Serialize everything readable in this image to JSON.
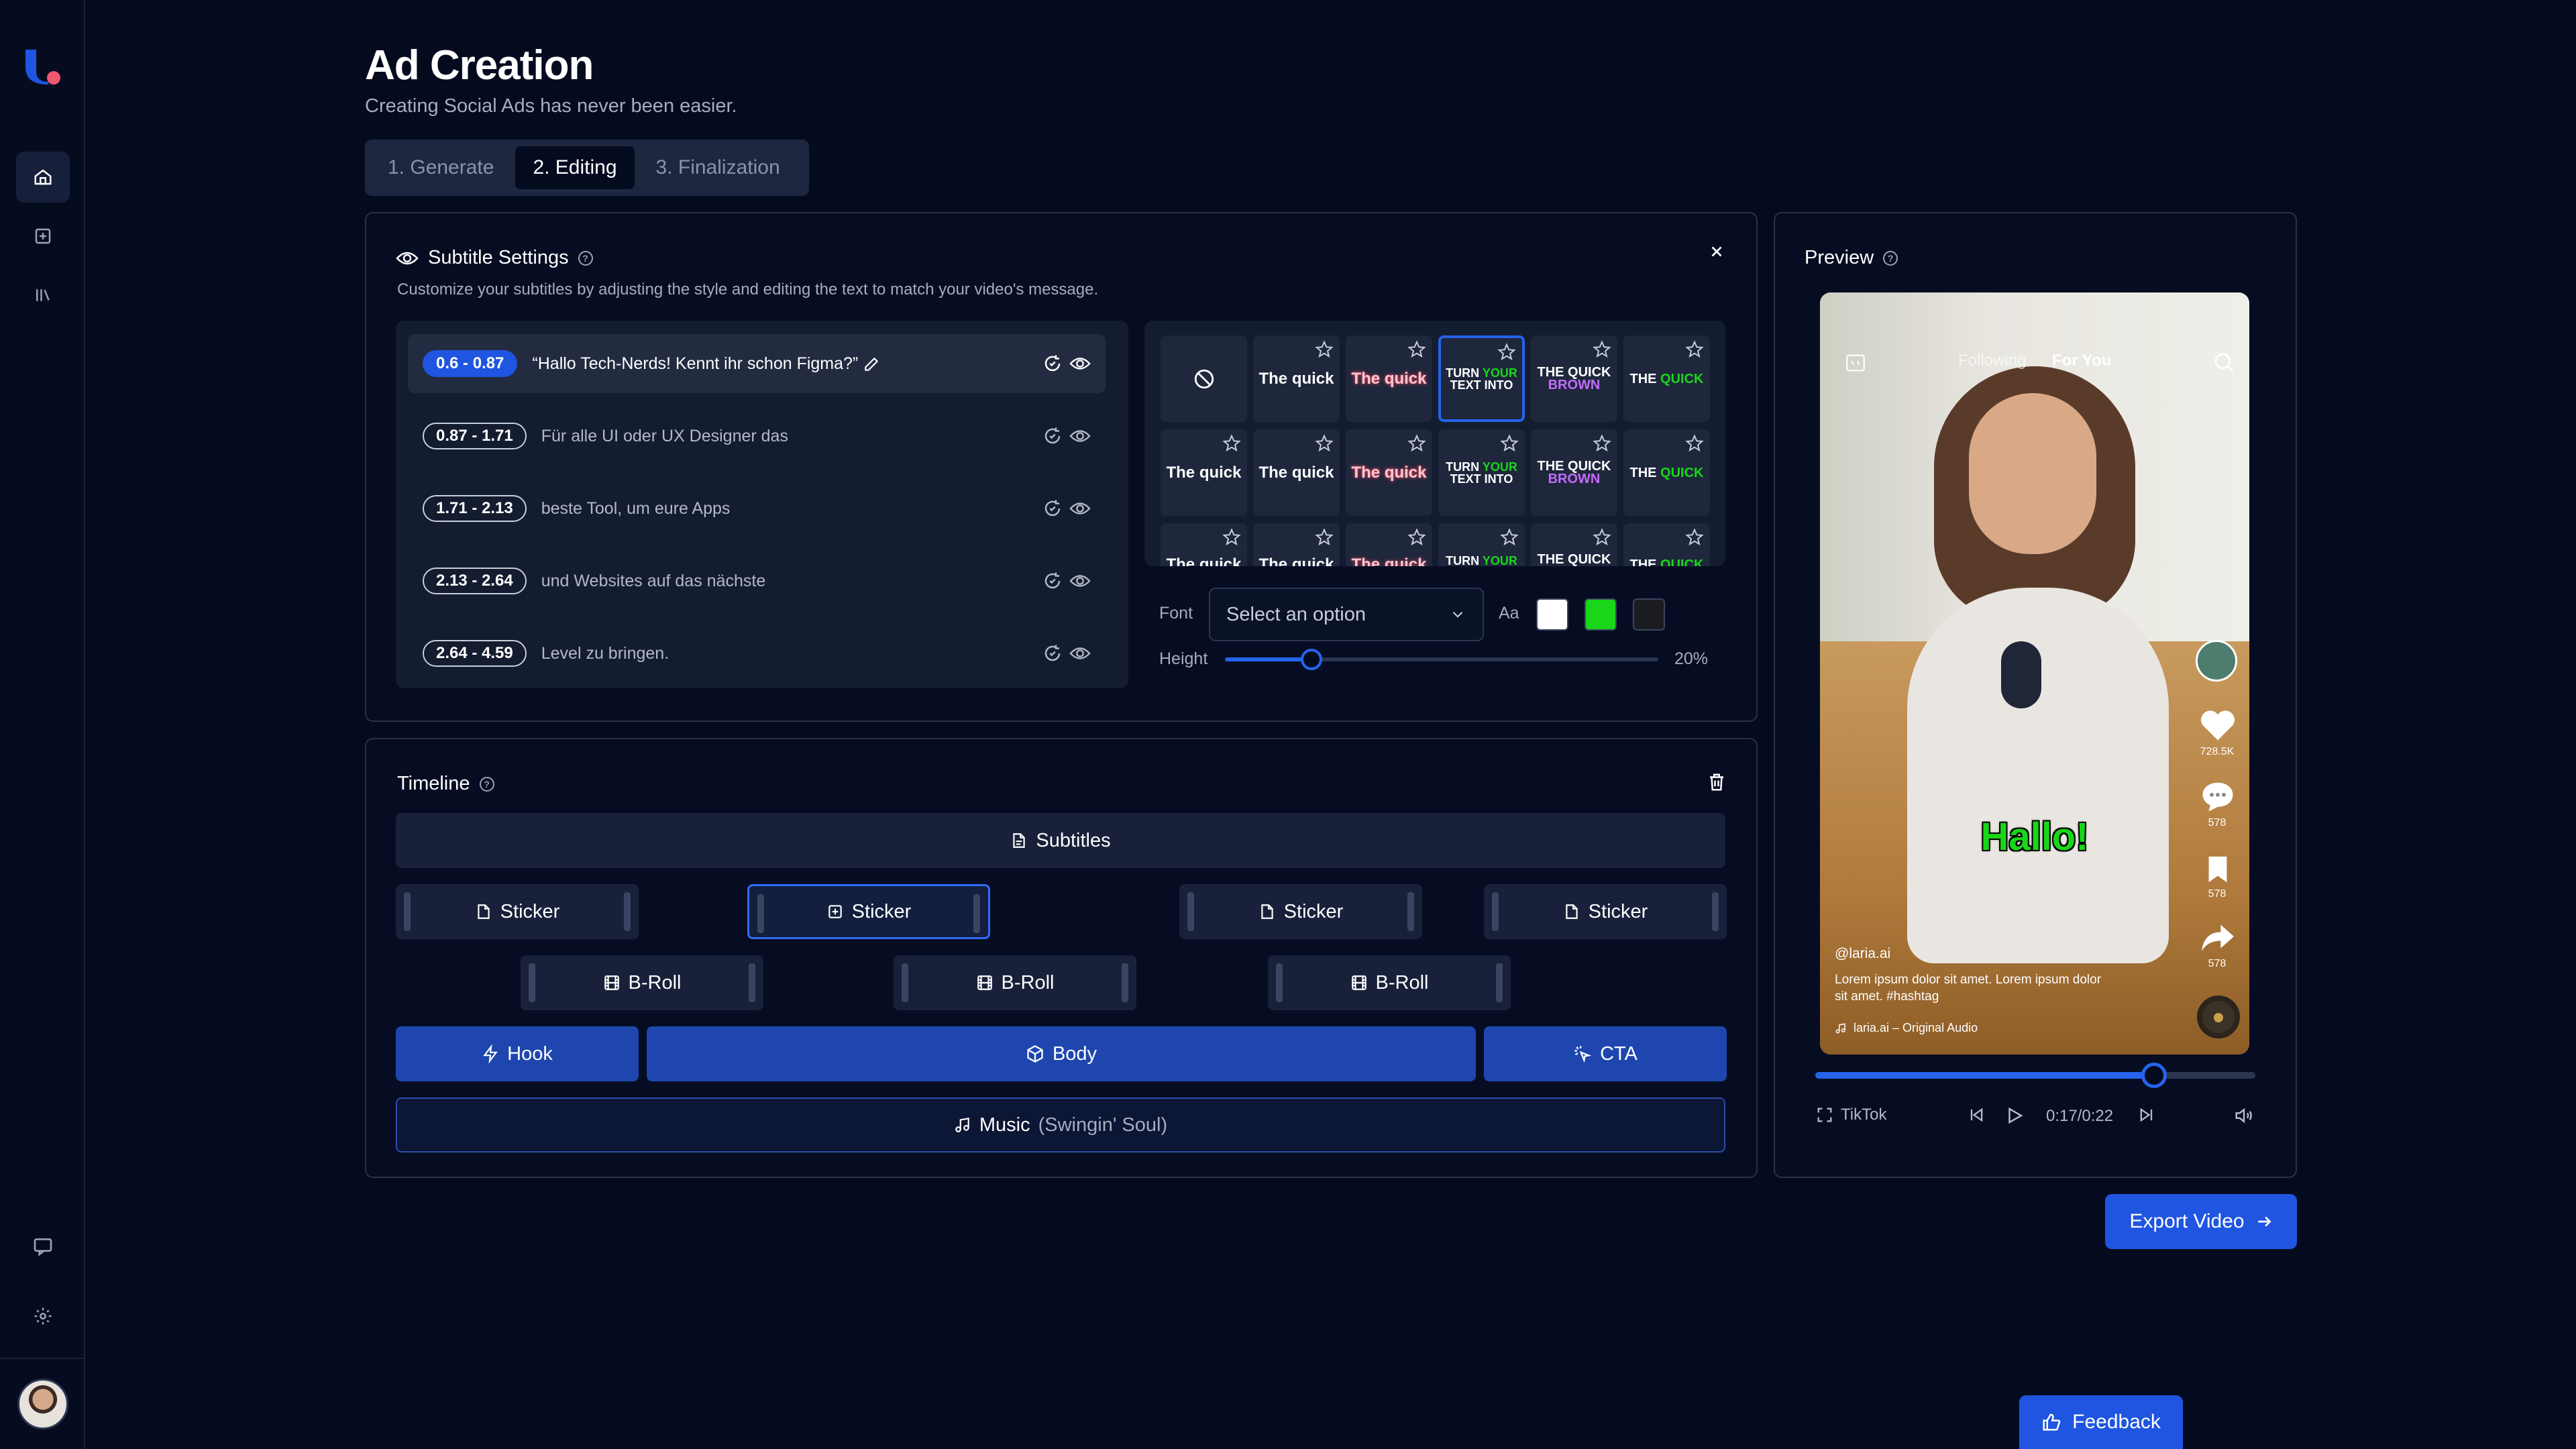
{
  "page": {
    "title": "Ad Creation",
    "subtitle": "Creating Social Ads has never been easier."
  },
  "tabs": [
    {
      "label": "1. Generate"
    },
    {
      "label": "2. Editing"
    },
    {
      "label": "3. Finalization"
    }
  ],
  "sidebar": {
    "icons": [
      "logo-icon",
      "home-icon",
      "add-square-icon",
      "library-icon",
      "chat-icon",
      "gear-icon",
      "avatar"
    ]
  },
  "subtitle_settings": {
    "title": "Subtitle Settings",
    "description": "Customize your subtitles by adjusting the style and editing the text to match your video's message.",
    "rows": [
      {
        "range": "0.6 - 0.87",
        "text": "“Hallo Tech-Nerds! Kennt ihr schon Figma?”"
      },
      {
        "range": "0.87 - 1.71",
        "text": "Für alle UI oder UX Designer das"
      },
      {
        "range": "1.71 - 2.13",
        "text": "beste Tool, um eure Apps"
      },
      {
        "range": "2.13 - 2.64",
        "text": "und Websites auf das nächste"
      },
      {
        "range": "2.64 - 4.59",
        "text": "Level zu bringen."
      }
    ],
    "styles": {
      "the_quick": "The quick",
      "turn_your": [
        "TURN ",
        "YOUR",
        "TEXT INTO"
      ],
      "quick_brown": [
        "THE QUICK",
        "BROWN"
      ],
      "the_quick_caps": [
        "THE ",
        "QUICK"
      ]
    },
    "font_label": "Font",
    "font_placeholder": "Select an option",
    "case_label": "Aa",
    "height_label": "Height",
    "height_value": "20%",
    "height_fraction": 0.2,
    "colors": [
      "#ffffff",
      "#19d619",
      "#1a1c22"
    ]
  },
  "timeline": {
    "title": "Timeline",
    "subtitles_label": "Subtitles",
    "sticker_label": "Sticker",
    "broll_label": "B-Roll",
    "hook_label": "Hook",
    "body_label": "Body",
    "cta_label": "CTA",
    "music_label": "Music",
    "music_track": "(Swingin' Soul)"
  },
  "preview": {
    "title": "Preview",
    "tab_following": "Following",
    "tab_foryou": "For You",
    "caption_word": "Hallo!",
    "handle": "@laria.ai",
    "caption": "Lorem ipsum dolor sit amet. Lorem ipsum dolor sit amet. #hashtag",
    "audio": "laria.ai – Original Audio",
    "likes": "728.5K",
    "comments": "578",
    "saves": "578",
    "shares": "578",
    "platform": "TikTok",
    "time": "0:17/0:22",
    "progress": 0.77
  },
  "actions": {
    "export": "Export Video",
    "feedback": "Feedback"
  },
  "colors": {
    "accent": "#1f55e0",
    "bg": "#050b1f",
    "panel_border": "#283149",
    "green": "#19d619"
  }
}
